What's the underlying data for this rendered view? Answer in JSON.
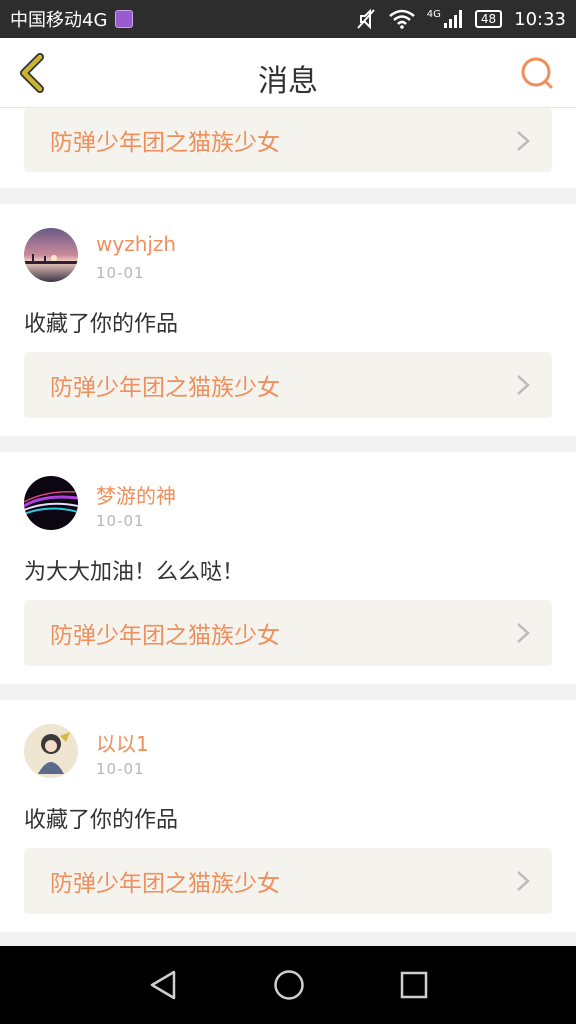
{
  "status_bar": {
    "carrier": "中国移动4G",
    "network": "4G",
    "battery": "48",
    "time": "10:33"
  },
  "header": {
    "title": "消息",
    "back_icon": "back-chevron-icon",
    "search_icon": "search-icon"
  },
  "partial_card": {
    "work_title": "防弹少年团之猫族少女"
  },
  "messages": [
    {
      "username": "wyzhjzh",
      "date": "10-01",
      "text": "收藏了你的作品",
      "work_title": "防弹少年团之猫族少女"
    },
    {
      "username": "梦游的神",
      "date": "10-01",
      "text": "为大大加油！么么哒！",
      "work_title": "防弹少年团之猫族少女"
    },
    {
      "username": "以以1",
      "date": "10-01",
      "text": "收藏了你的作品",
      "work_title": "防弹少年团之猫族少女"
    }
  ],
  "colors": {
    "accent": "#ef8f5b",
    "back_icon": "#c8b632",
    "card_link_bg": "#f4f3ed"
  }
}
